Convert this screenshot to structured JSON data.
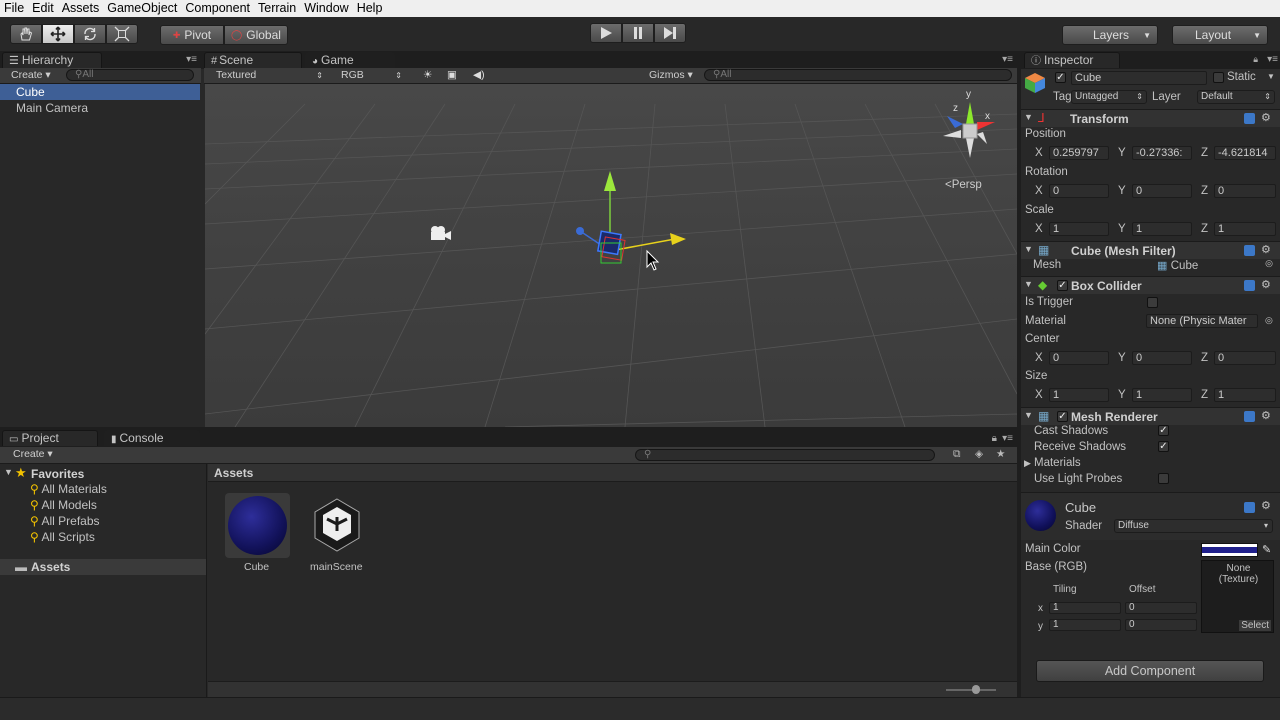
{
  "menu": [
    "File",
    "Edit",
    "Assets",
    "GameObject",
    "Component",
    "Terrain",
    "Window",
    "Help"
  ],
  "toolbar": {
    "pivot": "Pivot",
    "global": "Global",
    "layers": "Layers",
    "layout": "Layout"
  },
  "hierarchy": {
    "title": "Hierarchy",
    "create": "Create",
    "search": "All",
    "items": [
      "Cube",
      "Main Camera"
    ]
  },
  "scene": {
    "tab": "Scene",
    "game_tab": "Game",
    "render_mode": "Textured",
    "color_mode": "RGB",
    "gizmos": "Gizmos",
    "search": "All",
    "persp": "Persp",
    "gizmo_axes": {
      "y": "y",
      "x": "x",
      "z": "z"
    }
  },
  "project": {
    "title": "Project",
    "console": "Console",
    "create": "Create",
    "favorites": "Favorites",
    "fav_items": [
      "All Materials",
      "All Models",
      "All Prefabs",
      "All Scripts"
    ],
    "assets_root": "Assets",
    "assets_header": "Assets",
    "asset_items": [
      "Cube",
      "mainScene"
    ]
  },
  "inspector": {
    "title": "Inspector",
    "object_name": "Cube",
    "static_label": "Static",
    "tag_label": "Tag",
    "tag_value": "Untagged",
    "layer_label": "Layer",
    "layer_value": "Default",
    "transform": {
      "title": "Transform",
      "position_label": "Position",
      "rotation_label": "Rotation",
      "scale_label": "Scale",
      "position": [
        "0.259797",
        "-0.27336:",
        "-4.621814"
      ],
      "rotation": [
        "0",
        "0",
        "0"
      ],
      "scale": [
        "1",
        "1",
        "1"
      ]
    },
    "axis": {
      "x": "X",
      "y": "Y",
      "z": "Z"
    },
    "mesh_filter": {
      "title": "Cube (Mesh Filter)",
      "mesh_label": "Mesh",
      "mesh_value": "Cube"
    },
    "box_collider": {
      "title": "Box Collider",
      "is_trigger": "Is Trigger",
      "material_label": "Material",
      "material_value": "None (Physic Mater",
      "center_label": "Center",
      "center": [
        "0",
        "0",
        "0"
      ],
      "size_label": "Size",
      "size": [
        "1",
        "1",
        "1"
      ]
    },
    "mesh_renderer": {
      "title": "Mesh Renderer",
      "cast_shadows": "Cast Shadows",
      "receive_shadows": "Receive Shadows",
      "materials": "Materials",
      "light_probes": "Use Light Probes"
    },
    "material": {
      "name": "Cube",
      "shader_label": "Shader",
      "shader_value": "Diffuse",
      "main_color": "Main Color",
      "base": "Base (RGB)",
      "tiling": "Tiling",
      "offset": "Offset",
      "x": "x",
      "y": "y",
      "tiling_x": "1",
      "tiling_y": "1",
      "offset_x": "0",
      "offset_y": "0",
      "texture": "None\n(Texture)",
      "select": "Select",
      "color": "#20208c"
    },
    "add_component": "Add Component"
  },
  "colors": {
    "bg": "#282828",
    "panel": "#1f1f1f",
    "accent_blue": "#3c78c8",
    "scene_bg": "#424242"
  }
}
